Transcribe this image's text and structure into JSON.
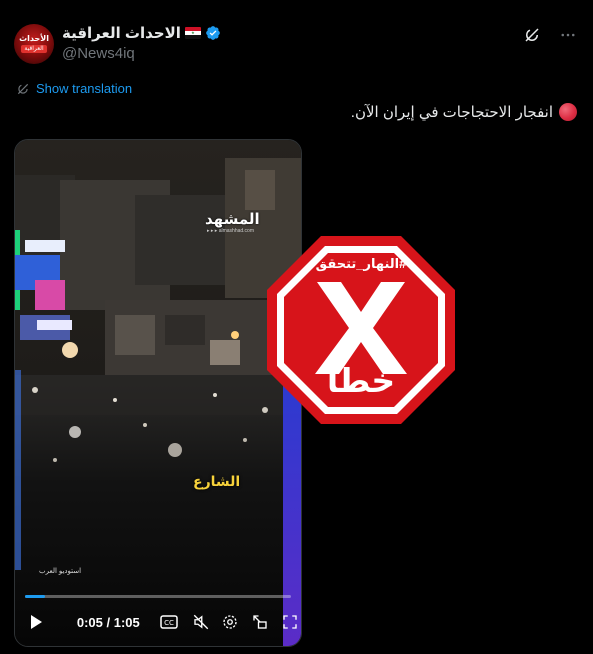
{
  "author": {
    "display_name": "الاحداث العراقية",
    "handle": "@News4iq",
    "avatar_title": "الأحداث",
    "avatar_subtitle": "العراقية",
    "flag_icon": "iraq-flag-icon",
    "verified_icon": "verified-badge-icon",
    "verified_color": "#1d9bf0"
  },
  "actions": {
    "grok_icon": "grok-icon",
    "more_icon": "more-horizontal-icon"
  },
  "translation": {
    "label": "Show translation",
    "icon": "translate-icon",
    "color": "#1d9bf0"
  },
  "tweet": {
    "text": "انفجار الاحتجاجات في إيران الآن.",
    "emoji_icon": "red-circle-icon"
  },
  "video": {
    "watermark_brand": "المشهد",
    "watermark_url": "▸ ▸ ▸ almashhad.com",
    "street_label": "الشارع",
    "studio_logo": "استوديو العرب",
    "current_time": "0:05",
    "duration": "1:05",
    "time_display": "0:05 / 1:05",
    "progress": 0.077,
    "controls": [
      "play-icon",
      "captions-icon",
      "mute-icon",
      "settings-icon",
      "picture-in-picture-icon",
      "fullscreen-icon"
    ]
  },
  "stamp": {
    "hashtag": "#النهار_تتحقق",
    "verdict": "خطأ",
    "color": "#d7141a"
  }
}
